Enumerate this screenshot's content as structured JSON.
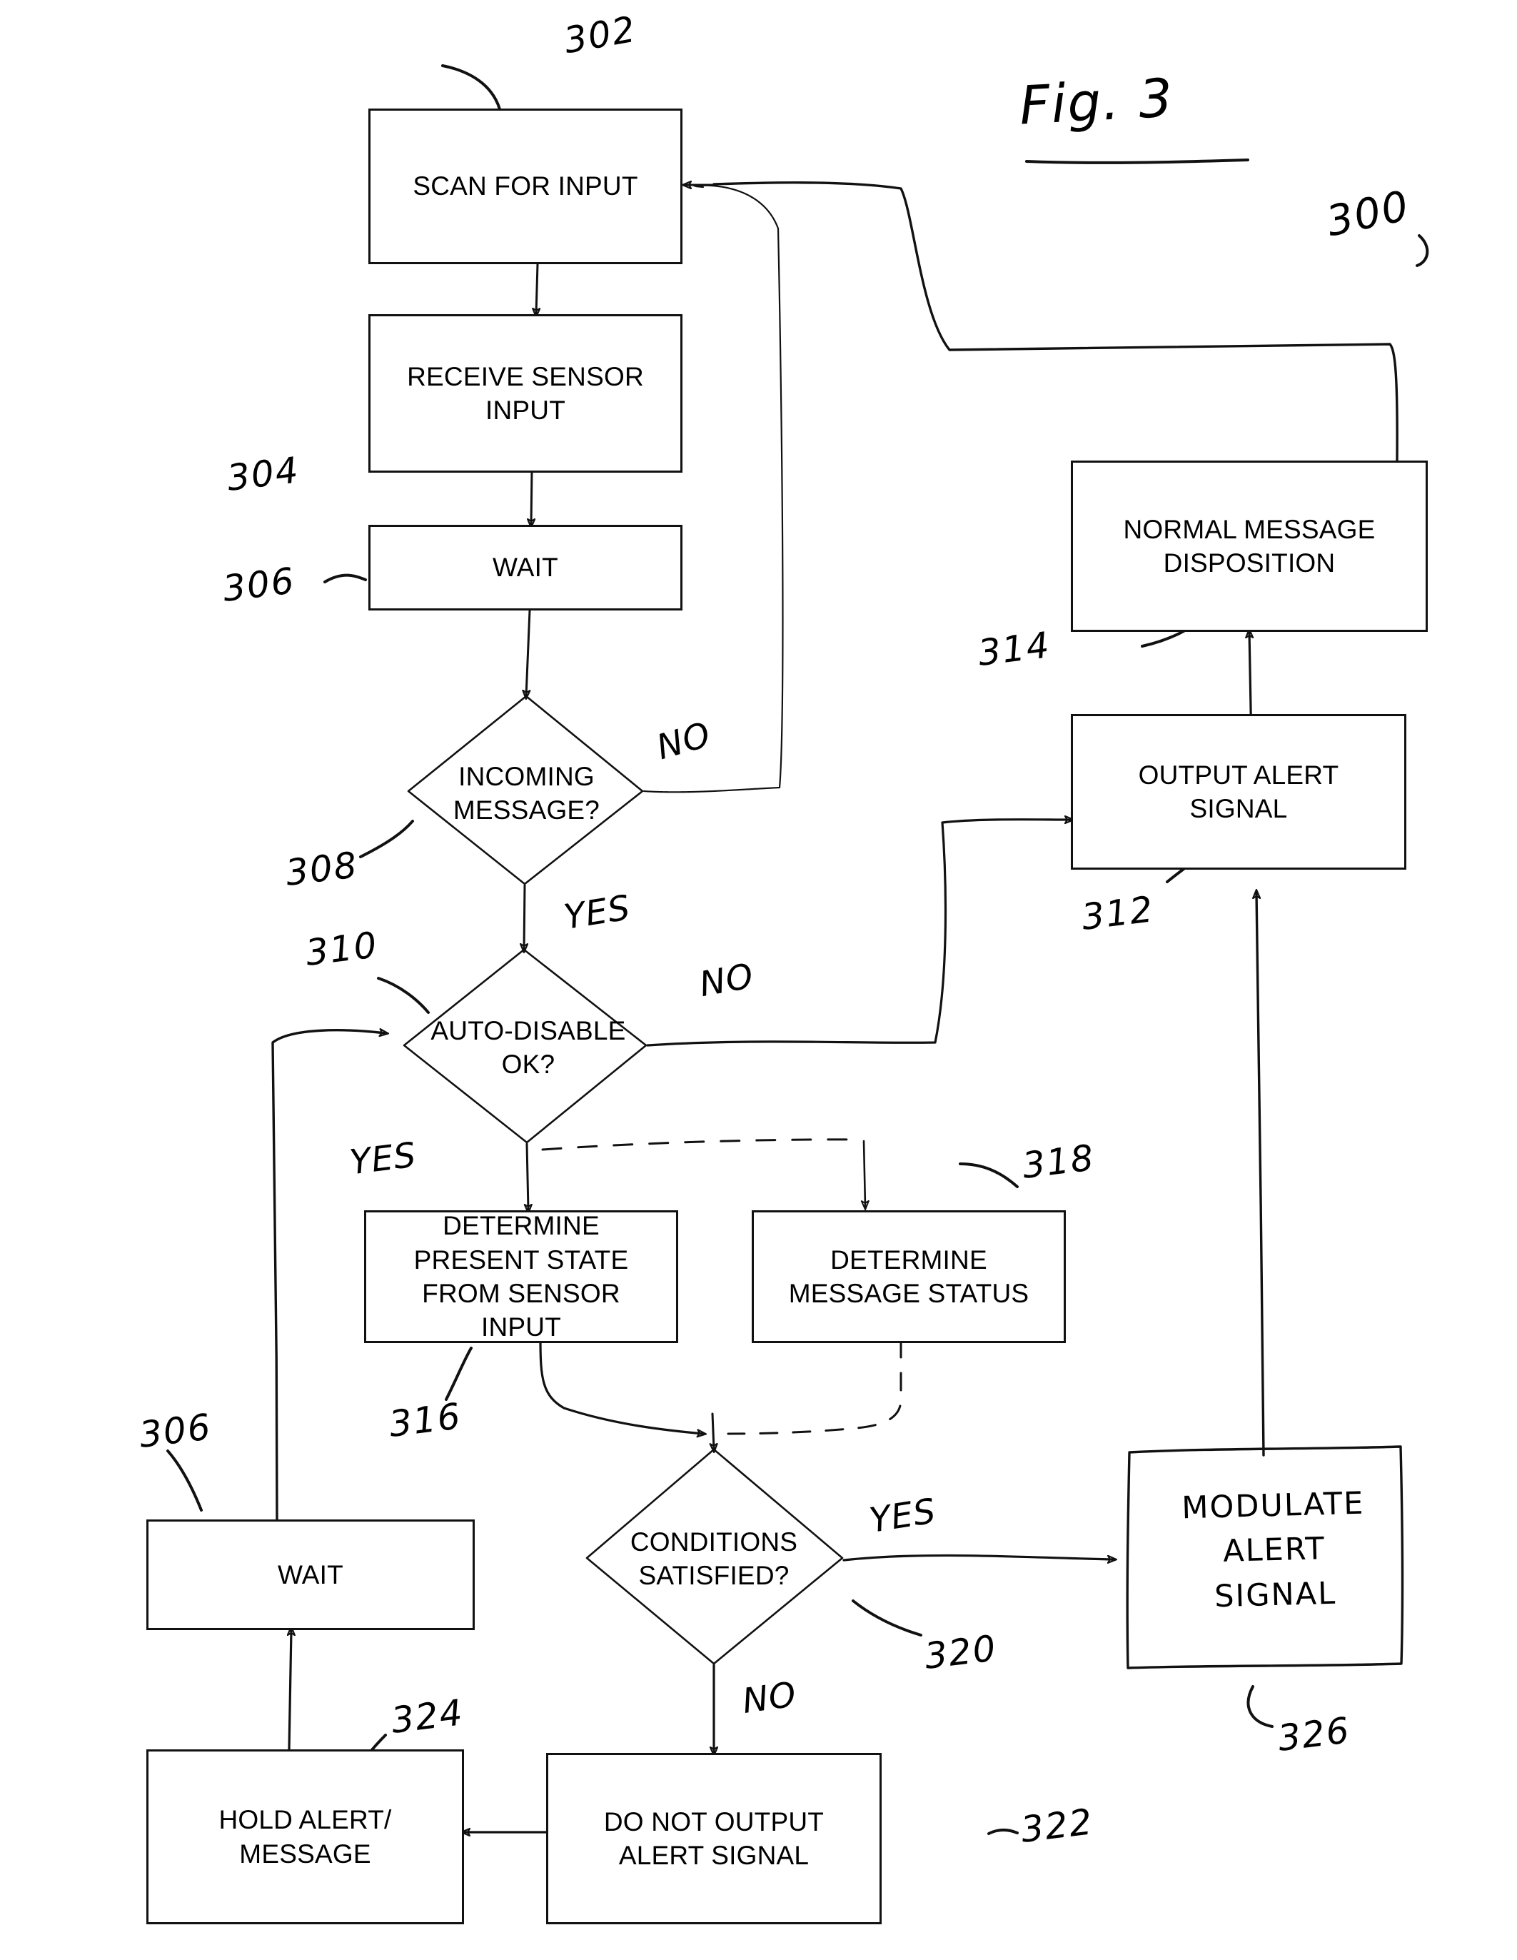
{
  "figure": {
    "title": "Fig. 3",
    "diagram_ref": "300"
  },
  "nodes": [
    {
      "id": "302",
      "shape": "process",
      "label": "SCAN FOR INPUT"
    },
    {
      "id": "304",
      "shape": "process",
      "label": "RECEIVE SENSOR INPUT"
    },
    {
      "id": "306a",
      "shape": "process",
      "label": "WAIT"
    },
    {
      "id": "308",
      "shape": "decision",
      "label": "INCOMING MESSAGE?"
    },
    {
      "id": "310",
      "shape": "decision",
      "label": "AUTO-DISABLE OK?"
    },
    {
      "id": "312",
      "shape": "process",
      "label": "OUTPUT ALERT SIGNAL"
    },
    {
      "id": "314",
      "shape": "process",
      "label": "NORMAL MESSAGE DISPOSITION"
    },
    {
      "id": "316",
      "shape": "process",
      "label": "DETERMINE PRESENT STATE FROM SENSOR INPUT"
    },
    {
      "id": "318",
      "shape": "process",
      "label": "DETERMINE MESSAGE STATUS"
    },
    {
      "id": "320",
      "shape": "decision",
      "label": "CONDITIONS SATISFIED?"
    },
    {
      "id": "322",
      "shape": "process",
      "label": "DO NOT OUTPUT ALERT SIGNAL"
    },
    {
      "id": "324",
      "shape": "process",
      "label": "HOLD ALERT/ MESSAGE"
    },
    {
      "id": "306b",
      "shape": "process",
      "label": "WAIT"
    },
    {
      "id": "326",
      "shape": "handdrawn",
      "label": "MODULATE ALERT SIGNAL"
    }
  ],
  "node_labels": {
    "scan_for_input": "SCAN FOR INPUT",
    "receive_sensor_input_line1": "RECEIVE SENSOR",
    "receive_sensor_input_line2": "INPUT",
    "wait_top": "WAIT",
    "incoming_message_line1": "INCOMING",
    "incoming_message_line2": "MESSAGE?",
    "auto_disable_line1": "AUTO-DISABLE",
    "auto_disable_line2": "OK?",
    "normal_message_line1": "NORMAL MESSAGE",
    "normal_message_line2": "DISPOSITION",
    "output_alert_line1": "OUTPUT ALERT",
    "output_alert_line2": "SIGNAL",
    "determine_present_state_line1": "DETERMINE",
    "determine_present_state_line2": "PRESENT STATE",
    "determine_present_state_line3": "FROM SENSOR",
    "determine_present_state_line4": "INPUT",
    "determine_message_status_line1": "DETERMINE",
    "determine_message_status_line2": "MESSAGE STATUS",
    "conditions_satisfied_line1": "CONDITIONS",
    "conditions_satisfied_line2": "SATISFIED?",
    "wait_bottom": "WAIT",
    "hold_alert_line1": "HOLD ALERT/",
    "hold_alert_line2": "MESSAGE",
    "do_not_output_line1": "DO NOT OUTPUT",
    "do_not_output_line2": "ALERT SIGNAL",
    "modulate_line1": "MODULATE",
    "modulate_line2": "ALERT",
    "modulate_line3": "SIGNAL"
  },
  "reference_numerals": {
    "ref_302": "302",
    "ref_304": "304",
    "ref_306_top": "306",
    "ref_308": "308",
    "ref_310": "310",
    "ref_312": "312",
    "ref_314": "314",
    "ref_316": "316",
    "ref_318": "318",
    "ref_320": "320",
    "ref_322": "322",
    "ref_324": "324",
    "ref_306_bottom": "306",
    "ref_326": "326",
    "ref_300": "300"
  },
  "branch_labels": {
    "incoming_no": "NO",
    "incoming_yes": "YES",
    "autodisable_no": "NO",
    "autodisable_yes": "YES",
    "conditions_yes": "YES",
    "conditions_no": "NO"
  },
  "colors": {
    "ink": "#111111",
    "background": "#ffffff"
  },
  "edges": [
    {
      "from": "302",
      "to": "304",
      "label": ""
    },
    {
      "from": "304",
      "to": "306a",
      "label": ""
    },
    {
      "from": "306a",
      "to": "308",
      "label": ""
    },
    {
      "from": "308",
      "to": "302",
      "label": "NO"
    },
    {
      "from": "308",
      "to": "310",
      "label": "YES"
    },
    {
      "from": "310",
      "to": "312",
      "label": "NO"
    },
    {
      "from": "310",
      "to": "316",
      "label": "YES"
    },
    {
      "from": "310",
      "to": "318",
      "label": ""
    },
    {
      "from": "314",
      "to": "302",
      "label": ""
    },
    {
      "from": "312",
      "to": "314",
      "label": ""
    },
    {
      "from": "316",
      "to": "320",
      "label": ""
    },
    {
      "from": "318",
      "to": "320",
      "label": ""
    },
    {
      "from": "320",
      "to": "326",
      "label": "YES"
    },
    {
      "from": "320",
      "to": "322",
      "label": "NO"
    },
    {
      "from": "322",
      "to": "324",
      "label": ""
    },
    {
      "from": "324",
      "to": "306b",
      "label": ""
    },
    {
      "from": "306b",
      "to": "310",
      "label": ""
    },
    {
      "from": "326",
      "to": "312",
      "label": ""
    }
  ]
}
